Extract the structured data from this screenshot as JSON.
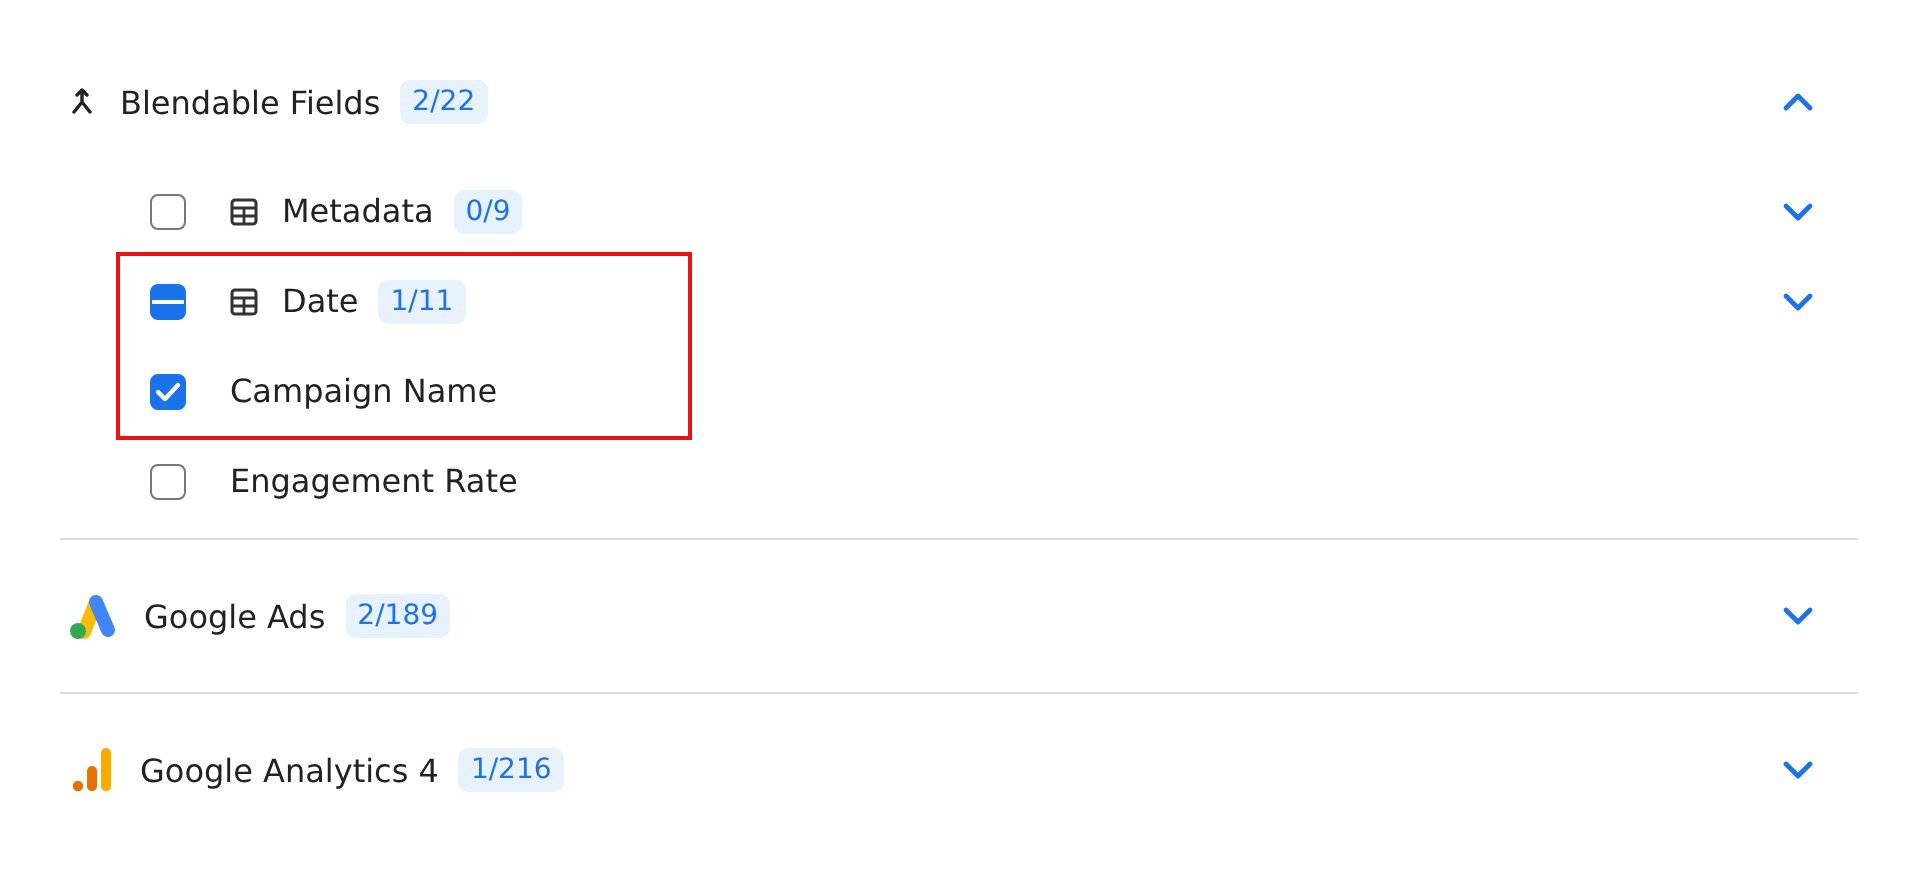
{
  "sections": [
    {
      "kind": "blend",
      "label": "Blendable Fields",
      "count": "2/22",
      "expanded": true,
      "children": [
        {
          "kind": "group",
          "label": "Metadata",
          "count": "0/9",
          "checked": false,
          "indeterminate": false,
          "expanded": false,
          "highlighted": false
        },
        {
          "kind": "group",
          "label": "Date",
          "count": "1/11",
          "checked": true,
          "indeterminate": true,
          "expanded": false,
          "highlighted": true
        },
        {
          "kind": "field",
          "label": "Campaign Name",
          "checked": true,
          "indeterminate": false,
          "highlighted": true
        },
        {
          "kind": "field",
          "label": "Engagement Rate",
          "checked": false,
          "indeterminate": false,
          "highlighted": false
        }
      ]
    },
    {
      "kind": "ads",
      "label": "Google Ads",
      "count": "2/189",
      "expanded": false
    },
    {
      "kind": "analytics",
      "label": "Google Analytics 4",
      "count": "1/216",
      "expanded": false
    }
  ]
}
